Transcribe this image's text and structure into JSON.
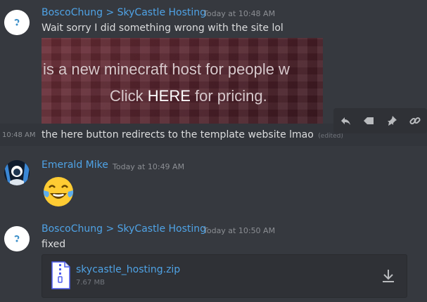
{
  "messages": [
    {
      "author": "BoscoChung > SkyCastle Hosting",
      "timestamp": "Today at 10:48 AM",
      "text": "Wait sorry I did something wrong with the site lol",
      "embed": {
        "line1": "is a new minecraft host for people w",
        "line2_before": "Click ",
        "line2_link": "HERE",
        "line2_after": " for pricing."
      }
    },
    {
      "side_timestamp": "10:48 AM",
      "text": "the here button redirects to the template website lmao",
      "edited_label": "(edited)"
    },
    {
      "author": "Emerald Mike",
      "timestamp": "Today at 10:49 AM",
      "emoji": "joy-emoji"
    },
    {
      "author": "BoscoChung > SkyCastle Hosting",
      "timestamp": "Today at 10:50 AM",
      "text": "fixed",
      "attachment": {
        "name": "skycastle_hosting.zip",
        "size": "7.67 MB"
      }
    }
  ],
  "toolbar": {
    "icons": [
      "reply-icon",
      "react-icon",
      "pin-icon",
      "link-icon"
    ]
  },
  "colors": {
    "background": "#36393f",
    "author": "#4fa3e6",
    "text": "#dcddde",
    "muted": "#8b8e93"
  }
}
